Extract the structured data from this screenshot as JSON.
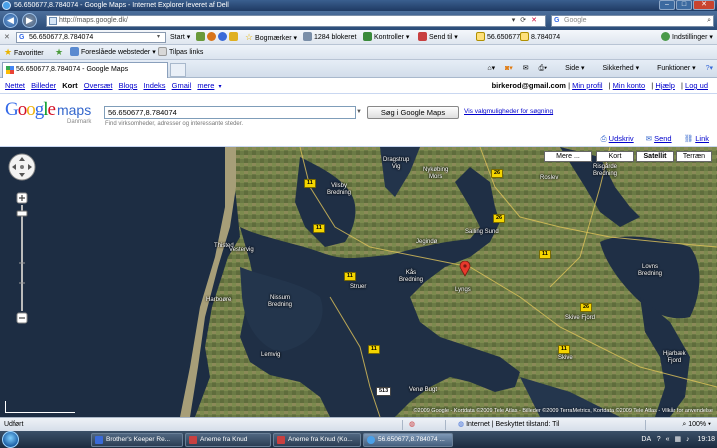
{
  "window": {
    "title": "56.650677,8.784074 - Google Maps - Internet Explorer leveret af Dell",
    "minimize": "–",
    "maximize": "□",
    "close": "✕"
  },
  "addressbar": {
    "url": "http://maps.google.dk/",
    "search_placeholder": "Google"
  },
  "google_toolbar": {
    "query": "56.650677,8.784074",
    "start_label": "Start",
    "bookmarks_label": "Bogmærker",
    "blocked_label": "1284 blokeret",
    "check_label": "Kontroller",
    "sendto_label": "Send til",
    "chip1": "56.650677",
    "chip2": "8.784074",
    "settings_label": "Indstillinger"
  },
  "favorites_bar": {
    "favorites_label": "Favoritter",
    "suggested_label": "Foreslåede websteder",
    "customize_label": "Tilpas links"
  },
  "tab": {
    "title": "56.650677,8.784074 - Google Maps"
  },
  "command_bar": {
    "page": "Side",
    "security": "Sikkerhed",
    "tools": "Funktioner"
  },
  "google_links": {
    "items": [
      "Nettet",
      "Billeder",
      "Kort",
      "Oversæt",
      "Blogs",
      "Indeks",
      "Gmail",
      "mere"
    ],
    "email": "birkerod@gmail.com",
    "profile": "Min profil",
    "account": "Min konto",
    "help": "Hjælp",
    "logout": "Log ud"
  },
  "search": {
    "logo_google": "Google",
    "logo_maps": "maps",
    "logo_country": "Danmark",
    "query": "56.650677,8.784074",
    "hint": "Find virksomheder, adresser og interessante steder.",
    "button": "Søg i Google Maps",
    "options_link": "Vis valgmuligheder for søgning"
  },
  "map_actions": {
    "print": "Udskriv",
    "send": "Send",
    "link": "Link"
  },
  "map": {
    "types": [
      "Mere ...",
      "Kort",
      "Satellit",
      "Terræn"
    ],
    "selected_type": "Satellit",
    "copyright": "©2009 Google - Kortdata ©2009 Tele Atlas - Billeder ©2009 TerraMetrics, Kortdata ©2009 Tele Atlas - Vilkår for anvendelse",
    "labels": {
      "thisted": "Thisted",
      "vestervig": "Vestervig",
      "harboore": "Harboøre",
      "nissum": "Nissum\nBredning",
      "kas": "Kås\nBredning",
      "lemvig": "Lemvig",
      "struer": "Struer",
      "venø": "Venø Bugt",
      "salling": "Salling Sund",
      "skive": "Skive Fjord",
      "lovns": "Lovns\nBredning",
      "risgaarde": "Risgårde\nBredning",
      "dragstrup": "Dragstrup\nVig",
      "vilsby": "Vilsby\nBredning",
      "hjarbæk": "Hjarbæk\nFjord",
      "jegindo": "Jegindø",
      "nykobing": "Nykøbing\nMors",
      "roslev": "Roslev",
      "skive_town": "Skive",
      "lyngs": "Lyngs"
    },
    "shields": [
      "11",
      "11",
      "11",
      "11",
      "11",
      "26",
      "26",
      "26",
      "513",
      "11"
    ]
  },
  "statusbar": {
    "left": "Udført",
    "zone": "Internet | Beskyttet tilstand: Til",
    "zoom": "100%"
  },
  "taskbar": {
    "items": [
      "Brother's Keeper Re...",
      "Anerne fra Knud",
      "Anerne fra Knud (Ko...",
      "56.650677,8.784074 ..."
    ],
    "lang": "DA",
    "time": "19:18"
  }
}
